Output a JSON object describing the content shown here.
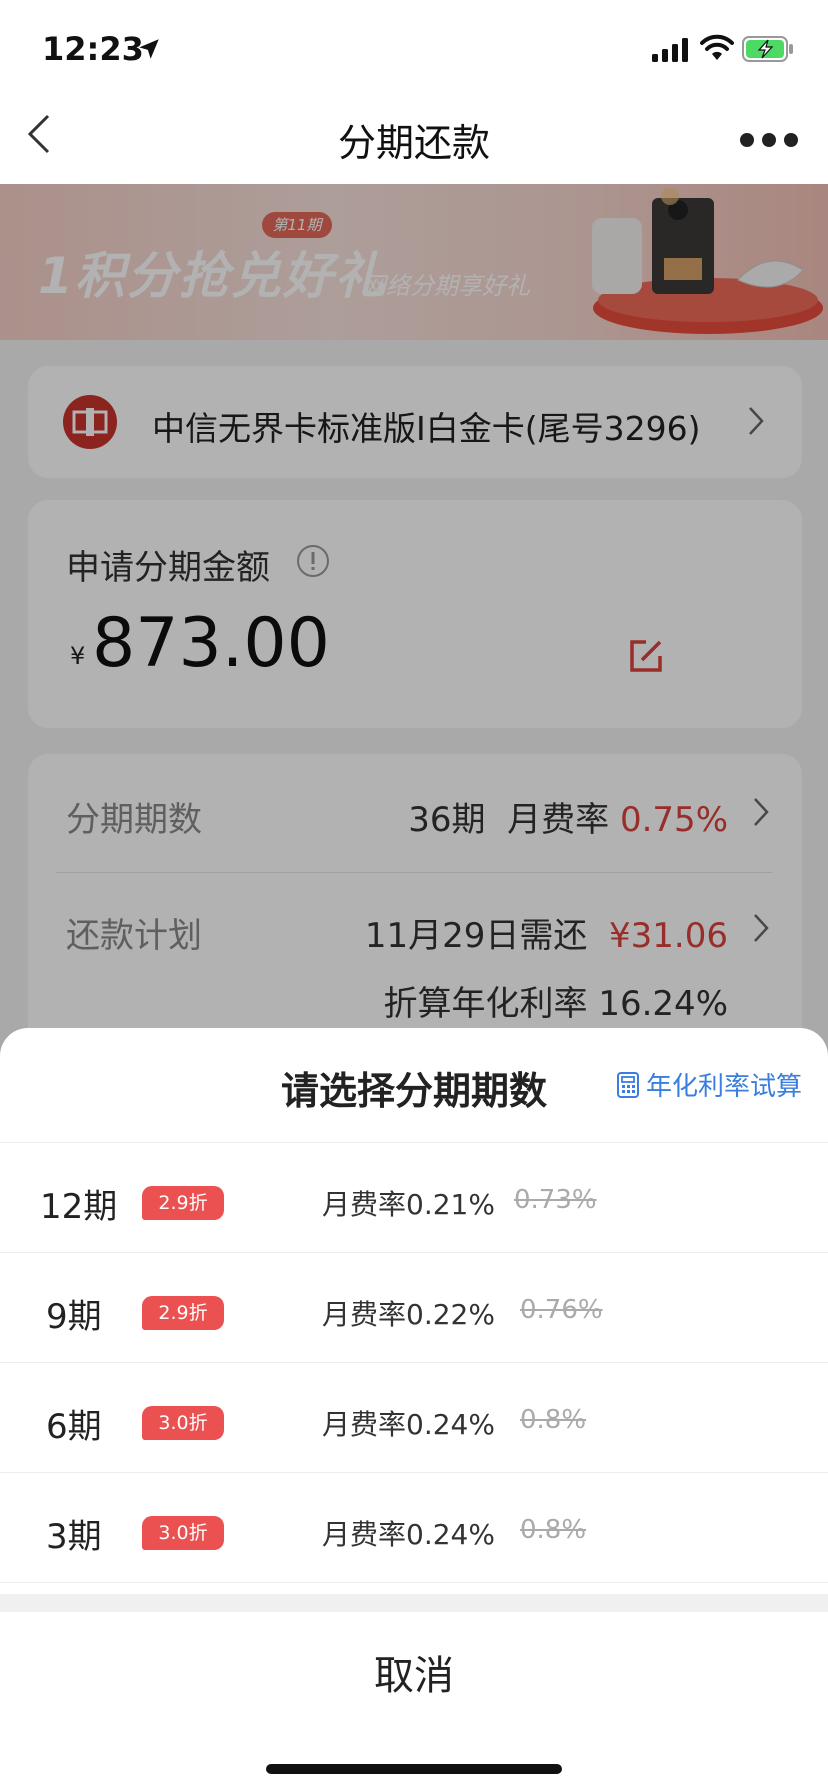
{
  "status_bar": {
    "time": "12:23"
  },
  "nav": {
    "title": "分期还款"
  },
  "banner": {
    "title": "1积分抢兑好礼",
    "badge": "第11期",
    "subtitle": "网络分期享好礼"
  },
  "card": {
    "name": "中信无界卡标准版I白金卡(尾号3296)"
  },
  "amount": {
    "label": "申请分期金额",
    "currency": "¥",
    "value": "873.00"
  },
  "plan": {
    "periods_label": "分期期数",
    "periods_value": "36期",
    "rate_label": "月费率",
    "rate_value": "0.75%",
    "repay_label": "还款计划",
    "repay_date_text": "11月29日需还",
    "repay_amount": "¥31.06",
    "annual_rate_text": "折算年化利率 16.24%"
  },
  "sheet": {
    "title": "请选择分期期数",
    "calc_link": "年化利率试算",
    "options": [
      {
        "period": "12期",
        "badge": "2.9折",
        "rate": "月费率0.21%",
        "old_rate": "0.73%"
      },
      {
        "period": "9期",
        "badge": "2.9折",
        "rate": "月费率0.22%",
        "old_rate": "0.76%"
      },
      {
        "period": "6期",
        "badge": "3.0折",
        "rate": "月费率0.24%",
        "old_rate": "0.8%"
      },
      {
        "period": "3期",
        "badge": "3.0折",
        "rate": "月费率0.24%",
        "old_rate": "0.8%"
      }
    ],
    "cancel": "取消"
  },
  "colors": {
    "accent_red": "#d9423b",
    "badge_red": "#ea5150",
    "link_blue": "#3a7ee0"
  },
  "icons": [
    "location-arrow-icon",
    "signal-icon",
    "wifi-icon",
    "battery-charging-icon",
    "back-chevron-icon",
    "more-dots-icon",
    "bank-logo-icon",
    "chevron-right-icon",
    "info-icon",
    "edit-icon",
    "calculator-icon"
  ]
}
